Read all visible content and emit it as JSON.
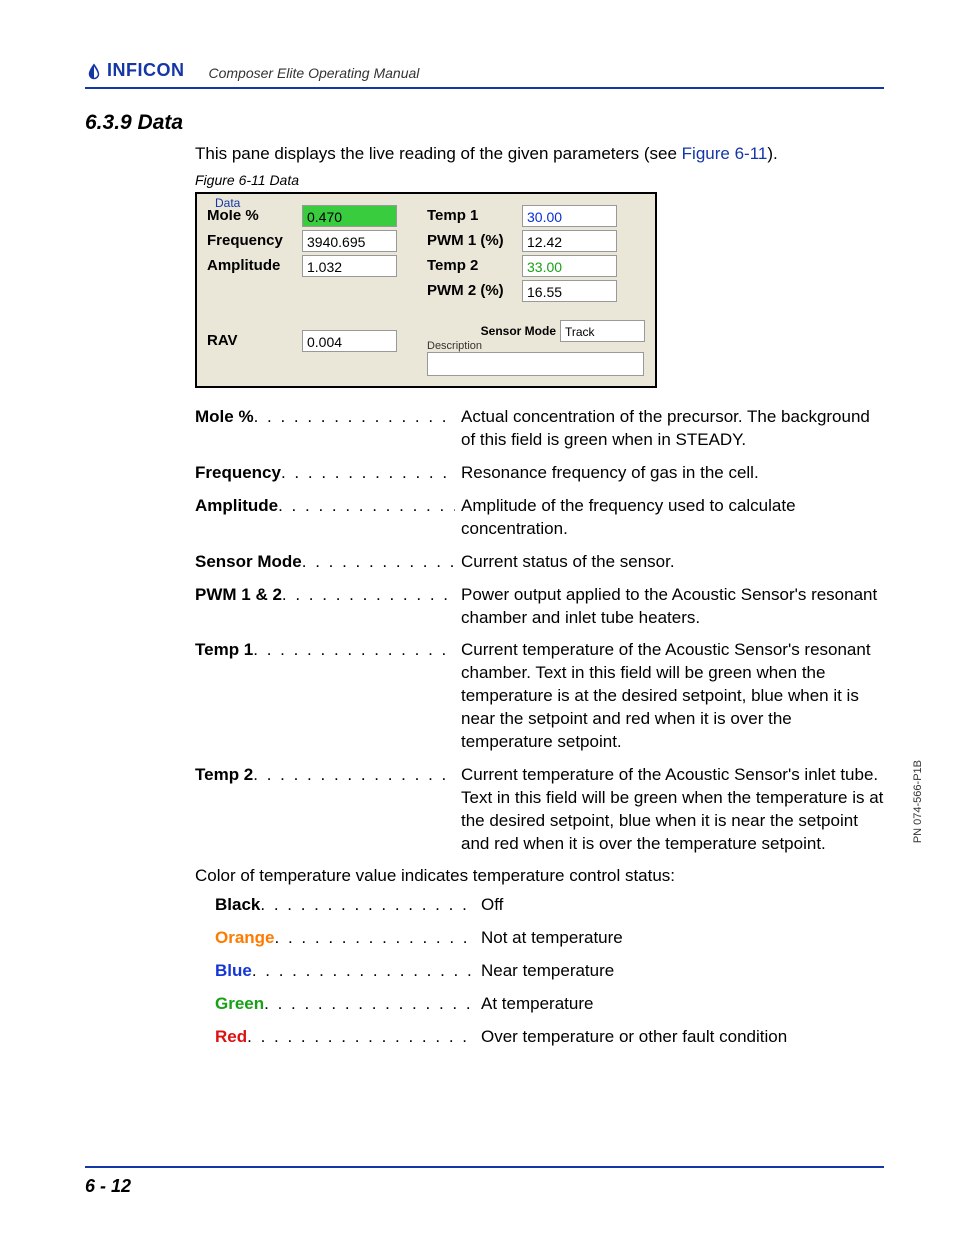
{
  "header": {
    "brand": "INFICON",
    "manual": "Composer Elite Operating Manual"
  },
  "section": {
    "number_title": "6.3.9  Data",
    "intro_prefix": "This pane displays the live reading of the given parameters (see ",
    "intro_xref": "Figure 6-11",
    "intro_suffix": ").",
    "figure_caption": "Figure 6-11  Data"
  },
  "panel": {
    "legend": "Data",
    "left": [
      {
        "label": "Mole %",
        "value": "0.470",
        "style": "green-bg"
      },
      {
        "label": "Frequency",
        "value": "3940.695",
        "style": ""
      },
      {
        "label": "Amplitude",
        "value": "1.032",
        "style": ""
      }
    ],
    "right": [
      {
        "label": "Temp 1",
        "value": "30.00",
        "style": "blue-txt"
      },
      {
        "label": "PWM 1 (%)",
        "value": "12.42",
        "style": ""
      },
      {
        "label": "Temp 2",
        "value": "33.00",
        "style": "green-txt"
      },
      {
        "label": "PWM 2 (%)",
        "value": "16.55",
        "style": ""
      }
    ],
    "sensor_mode_label": "Sensor Mode",
    "sensor_mode_value": "Track",
    "description_label": "Description",
    "rav_label": "RAV",
    "rav_value": "0.004"
  },
  "definitions": [
    {
      "term": "Mole %",
      "desc": "Actual concentration of the precursor. The background of this field is green when in STEADY."
    },
    {
      "term": "Frequency",
      "desc": "Resonance frequency of gas in the cell."
    },
    {
      "term": "Amplitude",
      "desc": "Amplitude of the frequency used to calculate concentration."
    },
    {
      "term": "Sensor Mode",
      "desc": "Current status of the sensor."
    },
    {
      "term": "PWM 1 & 2",
      "desc": "Power output applied to the Acoustic Sensor's resonant chamber and inlet tube heaters."
    },
    {
      "term": "Temp 1",
      "desc": "Current temperature of the Acoustic Sensor's resonant chamber. Text in this field will be green when the temperature is at the desired setpoint, blue when it is near the setpoint and red when it is over the temperature setpoint."
    },
    {
      "term": "Temp 2",
      "desc": "Current temperature of the Acoustic Sensor's inlet tube. Text in this field will be green when the temperature is at the desired setpoint, blue when it is near the setpoint and red when it is over the temperature setpoint."
    }
  ],
  "color_intro": "Color of temperature value indicates temperature control status:",
  "colors": [
    {
      "term": "Black",
      "class": "",
      "desc": "Off"
    },
    {
      "term": "Orange",
      "class": "c-orange",
      "desc": "Not at temperature"
    },
    {
      "term": "Blue",
      "class": "c-blue",
      "desc": "Near temperature"
    },
    {
      "term": "Green",
      "class": "c-green",
      "desc": "At temperature"
    },
    {
      "term": "Red",
      "class": "c-red",
      "desc": "Over temperature or other fault condition"
    }
  ],
  "footer": {
    "page": "6 - 12",
    "pn": "PN 074-566-P1B"
  }
}
